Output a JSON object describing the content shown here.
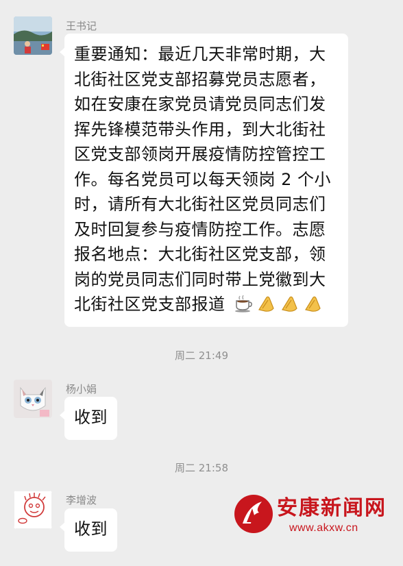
{
  "chat": {
    "messages": [
      {
        "sender": "王书记",
        "lines": [
          "重要通知：最近几天非常时期，大",
          "北街社区党支部招募党员志愿者，",
          "如在安康在家党员请党员同志们发",
          "挥先锋模范带头作用，到大北街社",
          "区党支部领岗开展疫情防控管控工",
          "作。每名党员可以每天领岗 2 个小",
          "时，请所有大北街社区党员同志们",
          "及时回复参与疫情防控工作。志愿",
          "报名地点：大北街社区党支部，领",
          "岗的党员同志们同时带上党徽到大",
          "北街社区党支部报道"
        ],
        "trailing_emoji": [
          "coffee-icon",
          "clap-icon",
          "clap-icon",
          "clap-icon"
        ]
      },
      {
        "sender": "杨小娟",
        "text": "收到"
      },
      {
        "sender": "李增波",
        "text": "收到"
      }
    ],
    "timestamps": [
      "周二 21:49",
      "周二 21:58"
    ]
  },
  "watermark": {
    "title": "安康新闻网",
    "url": "www.akxw.cn",
    "color": "#c8161d"
  },
  "colors": {
    "background": "#ededed",
    "bubble": "#ffffff"
  }
}
